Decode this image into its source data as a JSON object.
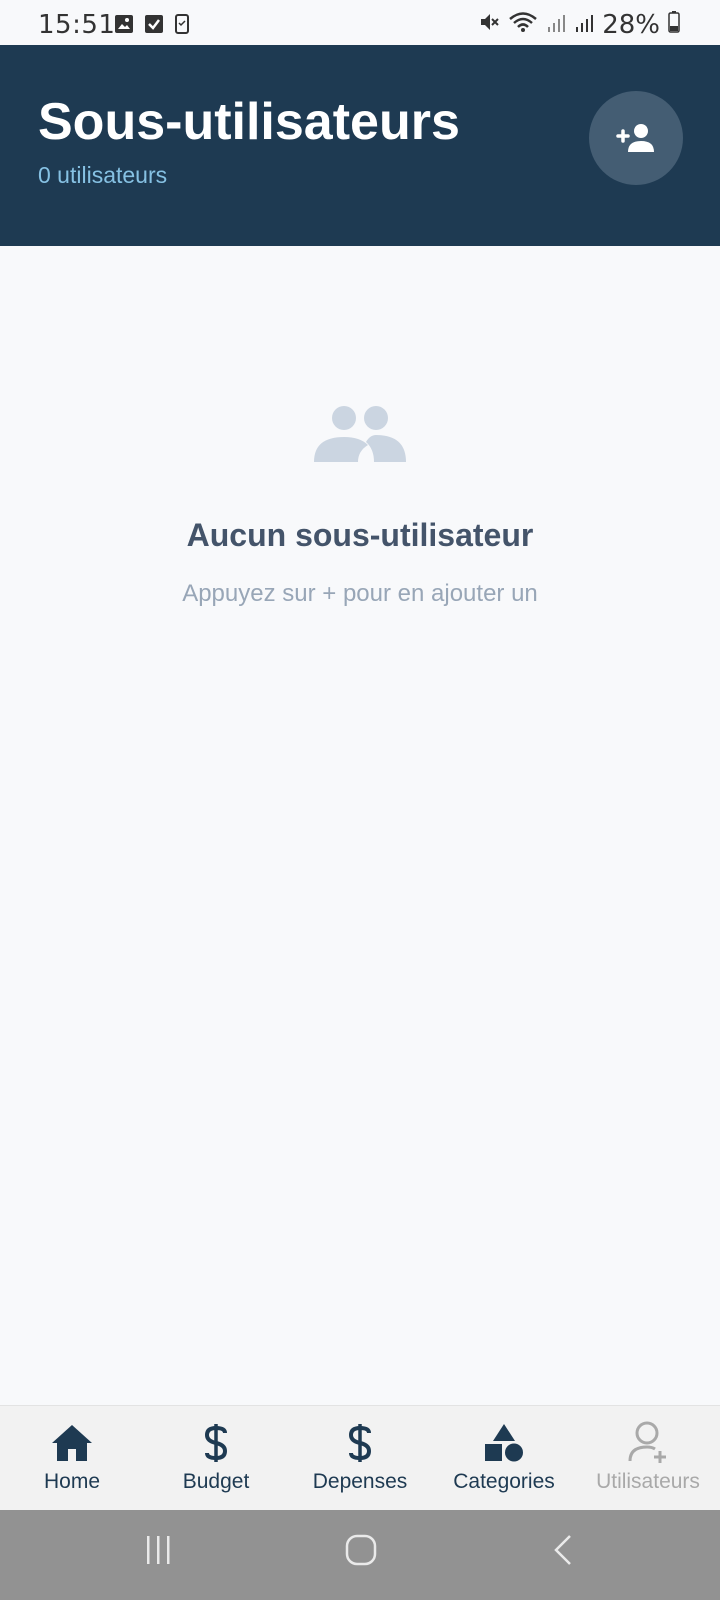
{
  "status_bar": {
    "time": "15:51",
    "battery": "28%",
    "icons": [
      "gallery-icon",
      "checkbox-icon",
      "phone-icon",
      "mute-icon",
      "wifi-icon",
      "signal-icon",
      "signal-icon",
      "battery-icon"
    ]
  },
  "header": {
    "title": "Sous-utilisateurs",
    "subtitle": "0 utilisateurs",
    "add_button_icon": "add-user-icon"
  },
  "empty_state": {
    "icon": "group-icon",
    "title": "Aucun sous-utilisateur",
    "hint": "Appuyez sur + pour en ajouter un"
  },
  "bottom_nav": {
    "items": [
      {
        "label": "Home",
        "icon": "home-icon",
        "active": true
      },
      {
        "label": "Budget",
        "icon": "dollar-icon",
        "active": true
      },
      {
        "label": "Depenses",
        "icon": "dollar-icon",
        "active": true
      },
      {
        "label": "Categories",
        "icon": "shapes-icon",
        "active": true
      },
      {
        "label": "Utilisateurs",
        "icon": "user-add-outline-icon",
        "active": false
      }
    ]
  },
  "system_nav": {
    "buttons": [
      "recents-icon",
      "home-circle-icon",
      "back-icon"
    ]
  },
  "colors": {
    "header_bg": "#1e3a52",
    "subtitle": "#86c1e3",
    "background": "#f8f9fb",
    "empty_icon": "#cbd5e1",
    "nav_active": "#1e3a52",
    "nav_inactive": "#a9a9a9"
  }
}
